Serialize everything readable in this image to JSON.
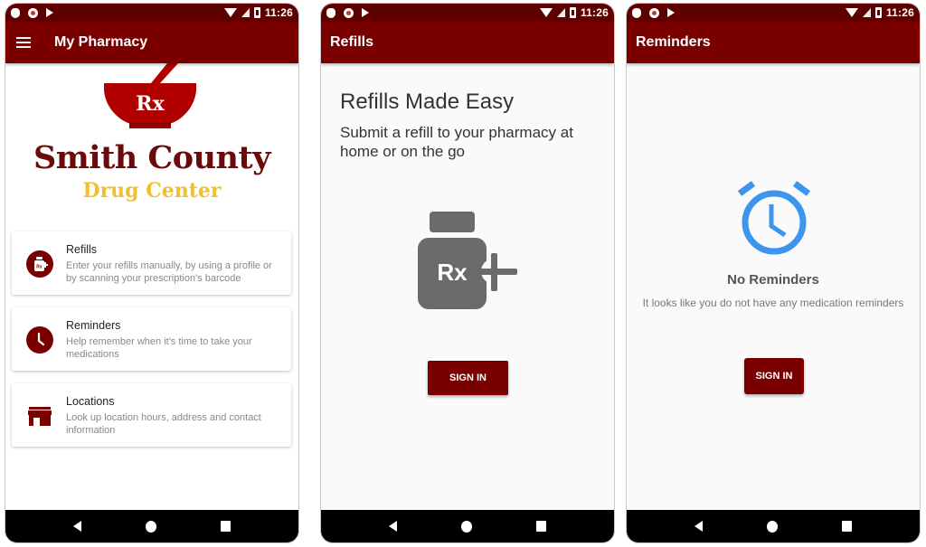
{
  "status_bar": {
    "time": "11:26",
    "left_icons": [
      "shield-icon",
      "record-icon",
      "play-store-icon"
    ],
    "right_icons": [
      "wifi-icon",
      "signal-icon",
      "battery-charging-icon"
    ]
  },
  "screens": [
    {
      "app_bar": {
        "title": "My Pharmacy",
        "nav_icon": "menu-icon"
      },
      "logo": {
        "rx_symbol": "Rx",
        "brand_name": "Smith County",
        "brand_sub": "Drug Center",
        "colors": {
          "mortar": "#b00000",
          "name": "#6b0a0a",
          "sub": "#f0c030"
        }
      },
      "cards": [
        {
          "icon": "pill-bottle-add-icon",
          "title": "Refills",
          "description": "Enter your refills manually, by using a profile or by scanning your prescription's barcode"
        },
        {
          "icon": "clock-icon",
          "title": "Reminders",
          "description": "Help remember when it's time to take your medications"
        },
        {
          "icon": "store-icon",
          "title": "Locations",
          "description": "Look up location hours, address and contact information"
        }
      ]
    },
    {
      "app_bar": {
        "title": "Refills"
      },
      "heading": "Refills Made Easy",
      "subheading": "Submit a refill to your pharmacy at home or on the go",
      "illustration": {
        "icon": "rx-bottle-add-icon",
        "label": "Rx"
      },
      "button": {
        "label": "SIGN IN"
      }
    },
    {
      "app_bar": {
        "title": "Reminders"
      },
      "illustration": {
        "icon": "alarm-clock-icon",
        "color": "#3d95ee"
      },
      "empty_title": "No Reminders",
      "empty_description": "It looks like you do not have any medication reminders",
      "button": {
        "label": "SIGN IN"
      }
    }
  ],
  "nav_bar": {
    "buttons": [
      "back",
      "home",
      "recents"
    ]
  },
  "theme": {
    "primary": "#7a0000",
    "status_bar": "#5e0000",
    "accent_blue": "#3d95ee",
    "icon_gray": "#6b6b6b"
  }
}
